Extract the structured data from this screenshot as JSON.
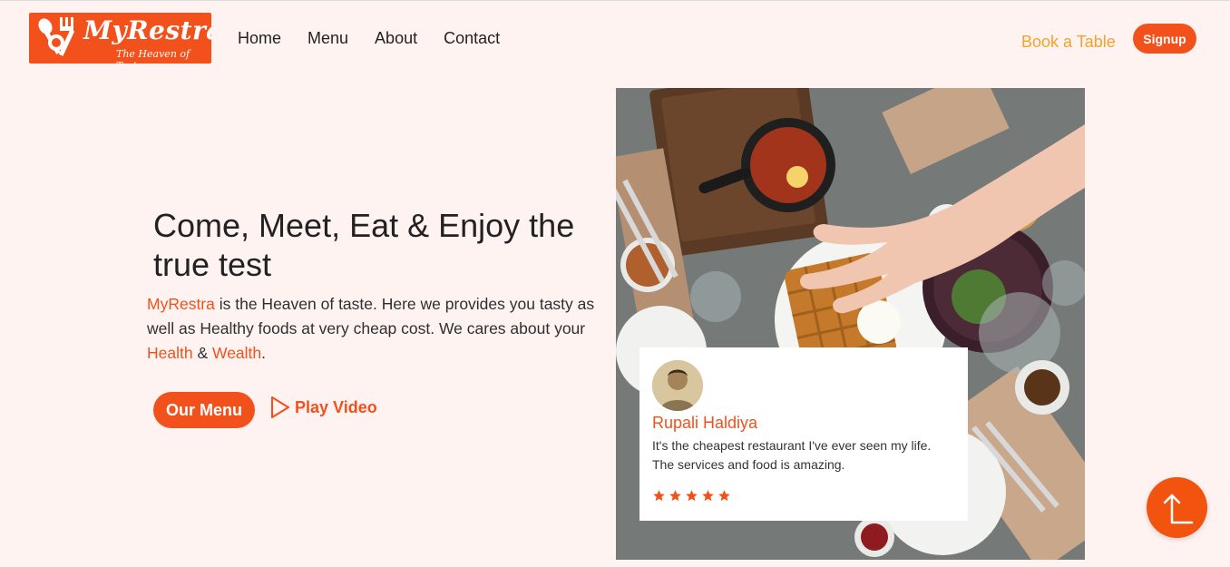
{
  "brand": {
    "name": "MyRestra",
    "tagline": "The Heaven of Taste"
  },
  "nav": {
    "links": [
      "Home",
      "Menu",
      "About",
      "Contact"
    ],
    "book_table": "Book a Table",
    "signup": "Signup"
  },
  "hero": {
    "title": "Come, Meet, Eat & Enjoy the true test",
    "desc_brand": "MyRestra",
    "desc_part1": " is the Heaven of taste. Here we provides you tasty as well as Healthy foods at very cheap cost. We cares about your ",
    "desc_health": "Health",
    "desc_amp": " & ",
    "desc_wealth": "Wealth",
    "desc_end": ".",
    "menu_button": "Our Menu",
    "play_video": "Play Video"
  },
  "review": {
    "name": "Rupali Haldiya",
    "text": "It's the cheapest restaurant I've ever seen my life. The services and food is amazing.",
    "rating": 5
  },
  "icons": {
    "play": "play-outline-icon",
    "star": "star-icon",
    "scroll_top": "arrow-up-icon",
    "logo": "fork-spoon-icon"
  },
  "colors": {
    "accent": "#f2511b",
    "book_table": "#f5a12a",
    "background": "#fff3f1"
  }
}
